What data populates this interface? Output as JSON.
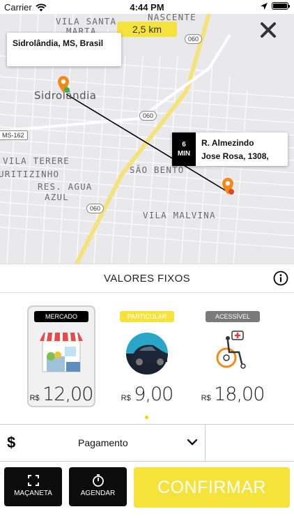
{
  "status_bar": {
    "carrier": "Carrier",
    "time": "4:44 PM"
  },
  "map": {
    "distance": "2,5 km",
    "origin": {
      "label": "Sidrolândia, MS, Brasil"
    },
    "destination": {
      "eta_number": "6",
      "eta_unit": "MIN",
      "address_line1": "R. Almezindo",
      "address_line2": "Jose Rosa, 1308,"
    },
    "labels": {
      "vila_santa": "VILA SANTA",
      "marta": "MARTA",
      "nascente": "NASCENTE",
      "sidrolandia": "Sidrolândia",
      "vila_terere": "VILA TERERE",
      "uritizinho": "URITIZINHO",
      "res_agua": "RES. AGUA",
      "azul": "AZUL",
      "sao_bento": "SÃO BENTO",
      "vila_malvina": "VILA MALVINA",
      "ms162": "MS-162"
    },
    "shields": {
      "r060_top": "060",
      "r060_mid": "060",
      "r060_bottom": "060"
    }
  },
  "fixed": {
    "title": "VALORES FIXOS"
  },
  "options": [
    {
      "tag": "MERCADO",
      "currency": "R$",
      "value": "12,00",
      "tag_bg": "#000000",
      "tag_color": "#ffffff"
    },
    {
      "tag": "PARTICULAR",
      "currency": "R$",
      "value": "9,00",
      "tag_bg": "#f5e23b",
      "tag_color": "#ffffff"
    },
    {
      "tag": "ACESSÍVEL",
      "currency": "R$",
      "value": "18,00",
      "tag_bg": "#7a7a7a",
      "tag_color": "#ffffff"
    }
  ],
  "payment": {
    "icon": "dollar-icon",
    "label": "Pagamento"
  },
  "bottom": {
    "macaneta": "MAÇANETA",
    "agendar": "AGENDAR",
    "confirm": "CONFIRMAR"
  },
  "colors": {
    "accent": "#f5e23b",
    "dark": "#0c0c0c",
    "pin": "#f28a1b"
  }
}
